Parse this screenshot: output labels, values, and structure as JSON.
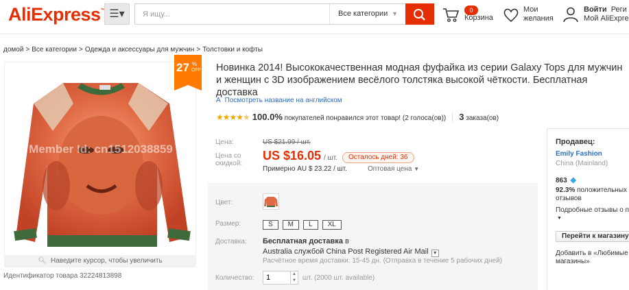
{
  "header": {
    "logo": "AliExpress",
    "logo_tm": "™",
    "search_placeholder": "Я ищу...",
    "category": "Все категории",
    "cart_count": "0",
    "cart_label": "Корзина",
    "wish_line1": "Мои",
    "wish_line2": "желания",
    "login_line1": "Войти",
    "login_line1_tail": "Реги",
    "login_line2": "Мой AliExpres"
  },
  "breadcrumb": [
    "домой",
    "Все категории",
    "Одежда и аксессуары для мужчин",
    "Толстовки и кофты"
  ],
  "gallery": {
    "discount_value": "27",
    "discount_pct": "%",
    "discount_off": "OFF",
    "zoom_hint": "Наведите курсор, чтобы увеличить",
    "product_id": "Идентификатор товара 32224813898",
    "watermark": "Member Id: cn1512038859"
  },
  "product": {
    "title": "Новинка 2014! Высококачественная модная фуфайка из серии Galaxy Tops для мужчин и женщин с 3D изображением весёлого толстяка высокой чёткости. Бесплатная доставка",
    "translate_icon": "A",
    "translate_link": "Посмотреть название на английском",
    "rating_stars": 4.5,
    "rating_percent": "100.0%",
    "rating_text": "покупателей понравился этот товар! (2 голоса(ов))",
    "orders_count": "3",
    "orders_label": "заказа(ов)"
  },
  "price": {
    "price_label": "Цена:",
    "old_price": "US $21.99 / шт.",
    "discount_label_1": "Цена со",
    "discount_label_2": "скидкой:",
    "new_price": "US $16.05",
    "per_unit": "/ шт.",
    "days_left": "Осталось дней: 36",
    "approx": "Примерно AU $ 23.22 / шт.",
    "wholesale": "Оптовая цена"
  },
  "sku": {
    "color_label": "Цвет:",
    "size_label": "Размер:",
    "sizes": [
      "S",
      "M",
      "L",
      "XL"
    ],
    "shipping_label": "Доставка:",
    "shipping_free": "Бесплатная доставка",
    "shipping_to": "в",
    "shipping_method": "Australia службой China Post Registered Air Mail",
    "shipping_time": "Расчётное время доставки: 15-45 дн. (Отправка в течение 5 рабочих дней)",
    "qty_label": "Количество:",
    "qty_value": "1",
    "qty_avail": "шт. (2000 шт. available)"
  },
  "seller": {
    "heading": "Продавец:",
    "name": "Emily Fashion",
    "location": "China (Mainland)",
    "score": "863",
    "positive_pct": "92.3%",
    "positive_text": "положительных отзывов",
    "detail_text": "Подробные отзывы о пр",
    "store_button": "Перейти к магазину",
    "favorites": "Добавить в «Любимые магазины»"
  },
  "colors": {
    "brand": "#e62e04",
    "discount_badge": "#ff7a00",
    "link": "#2f6ec3",
    "star": "#f2a600"
  },
  "icons": [
    "menu-icon",
    "search-icon",
    "cart-icon",
    "heart-icon",
    "user-icon",
    "translate-icon",
    "magnifier-icon",
    "diamond-icon",
    "chevron-down-icon"
  ]
}
